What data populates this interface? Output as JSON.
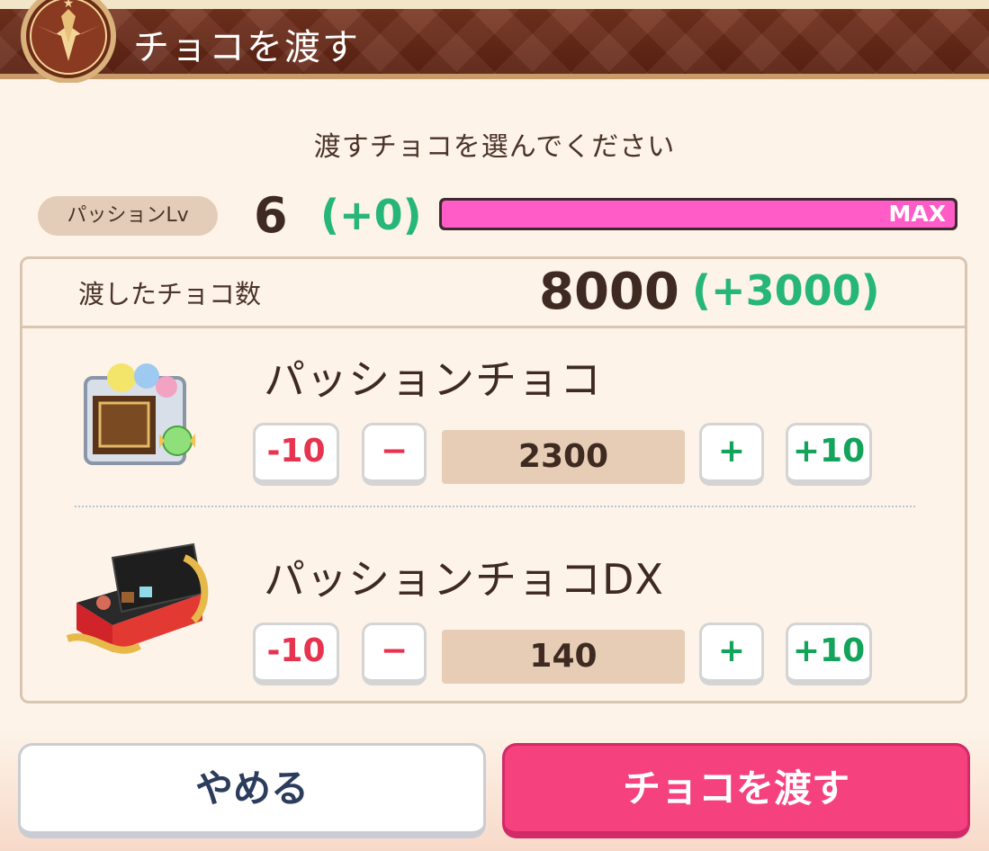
{
  "header": {
    "title": "チョコを渡す"
  },
  "instruction": "渡すチョコを選んでください",
  "passion": {
    "badge": "パッションLv",
    "level": "6",
    "delta": "(+0)",
    "bar_label": "MAX",
    "bar_fill_fraction": 1.0,
    "bar_color": "#ff5cc8"
  },
  "given": {
    "label": "渡したチョコ数",
    "value": "8000",
    "delta": "(+3000)"
  },
  "items": [
    {
      "name": "パッションチョコ",
      "icon": "chocolate-jar-icon",
      "count": "2300",
      "minus10": "-10",
      "minus": "−",
      "plus": "+",
      "plus10": "+10"
    },
    {
      "name": "パッションチョコDX",
      "icon": "chocolate-box-icon",
      "count": "140",
      "minus10": "-10",
      "minus": "−",
      "plus": "+",
      "plus10": "+10"
    }
  ],
  "buttons": {
    "cancel": "やめる",
    "confirm": "チョコを渡す"
  },
  "colors": {
    "accent_green": "#27b67a",
    "confirm_pink": "#f5427f",
    "minus_red": "#e6334f",
    "plus_green": "#13a35b"
  }
}
